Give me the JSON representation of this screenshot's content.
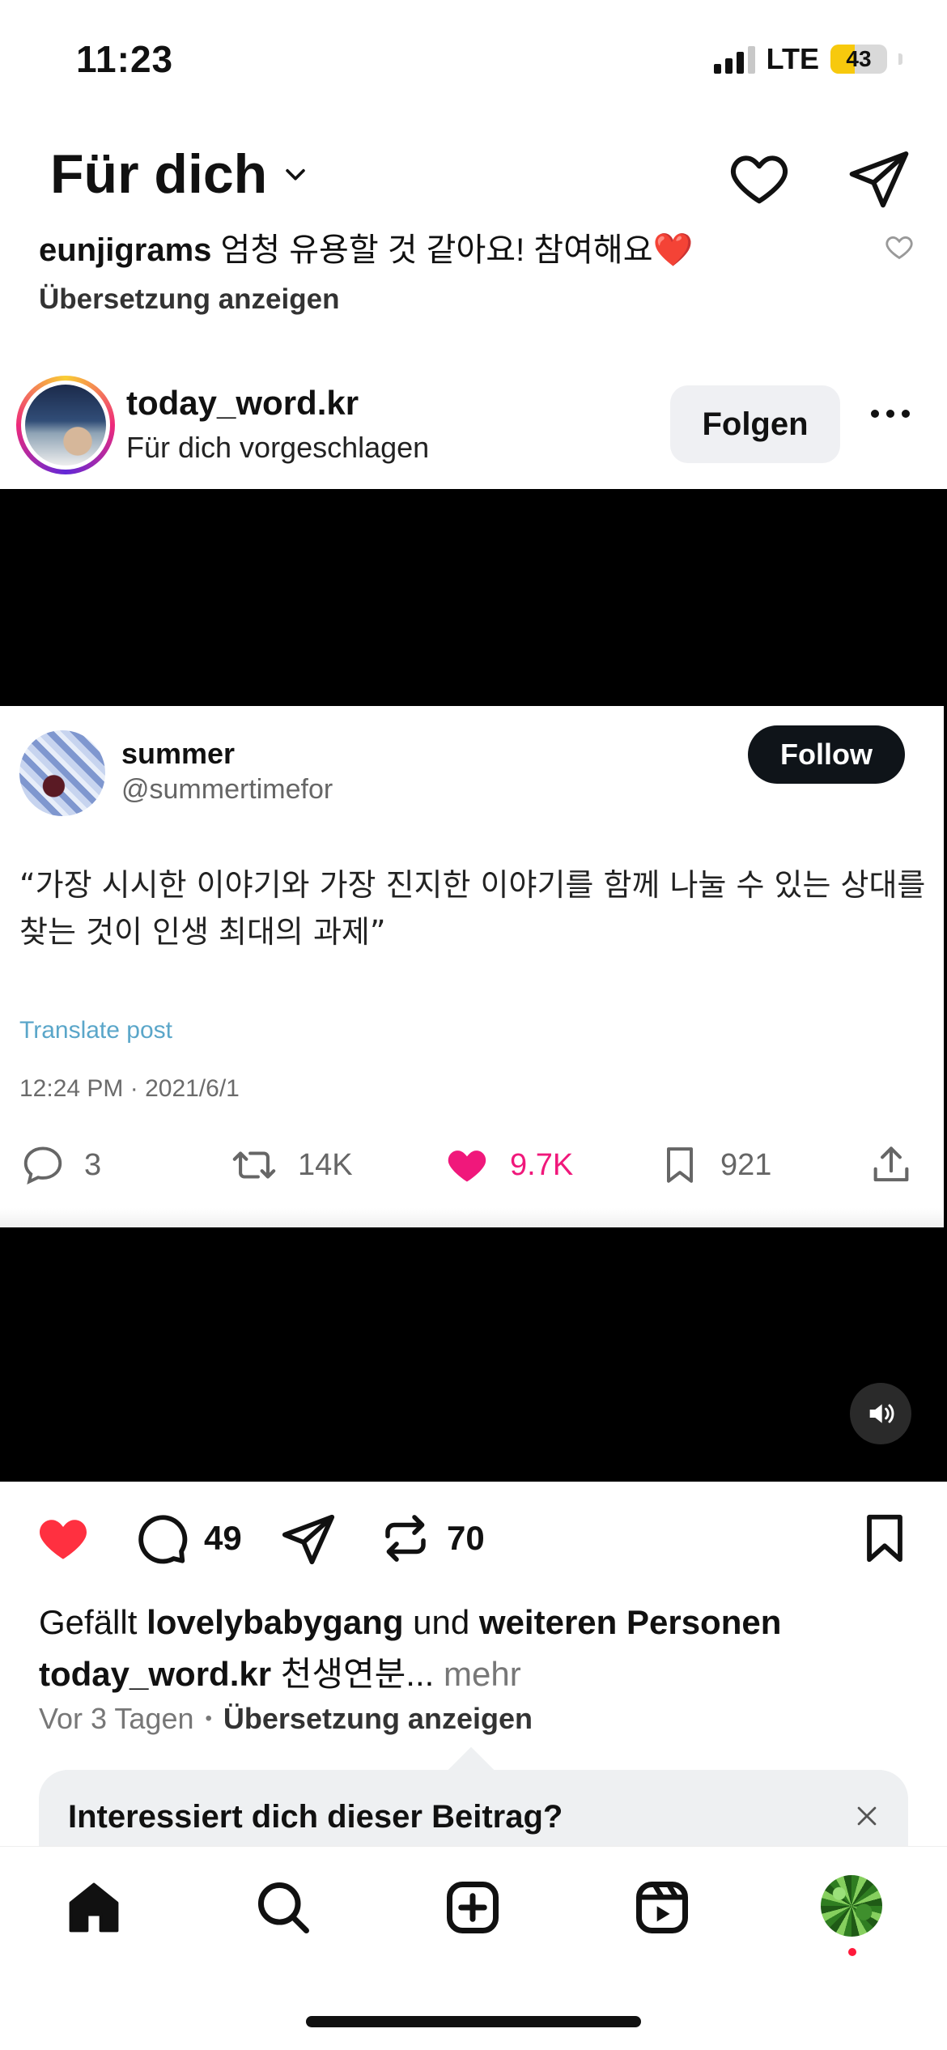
{
  "status_bar": {
    "time": "11:23",
    "network": "LTE",
    "battery": "43",
    "battery_level": 0.43
  },
  "header": {
    "title": "Für dich"
  },
  "previous_comment": {
    "user": "eunjigrams",
    "text": "엄청 유용할 것 같아요! 참여해요❤️",
    "translate_label": "Übersetzung anzeigen"
  },
  "post": {
    "username": "today_word.kr",
    "subtitle": "Für dich vorgeschlagen",
    "follow_label": "Folgen"
  },
  "tweet": {
    "name": "summer",
    "handle": "@summertimefor",
    "follow_label": "Follow",
    "text": "“가장 시시한 이야기와 가장 진지한 이야기를 함께 나눌 수 있는 상대를 찾는 것이 인생 최대의 과제”",
    "translate_label": "Translate post",
    "timestamp": "12:24 PM · 2021/6/1",
    "replies": "3",
    "retweets": "14K",
    "likes": "9.7K",
    "bookmarks": "921"
  },
  "actions": {
    "comments": "49",
    "reposts": "70"
  },
  "likes_line": {
    "prefix": "Gefällt",
    "user": "lovelybabygang",
    "middle": "und",
    "others": "weiteren Personen"
  },
  "caption": {
    "user": "today_word.kr",
    "text": "천생연분...",
    "more": "mehr"
  },
  "meta": {
    "age": "Vor 3 Tagen",
    "separator": "•",
    "translate_label": "Übersetzung anzeigen"
  },
  "interest_prompt": {
    "text": "Interessiert dich dieser Beitrag?"
  },
  "colors": {
    "like_red": "#ff3040",
    "tweet_like_pink": "#f0187b",
    "tweet_follow_bg": "#0f1419",
    "follow_btn_bg": "#eff0f3",
    "battery_yellow": "#f7c90d"
  },
  "tabbar": {
    "items": [
      "home-icon",
      "search-icon",
      "create-icon",
      "reels-icon",
      "profile-avatar"
    ]
  }
}
